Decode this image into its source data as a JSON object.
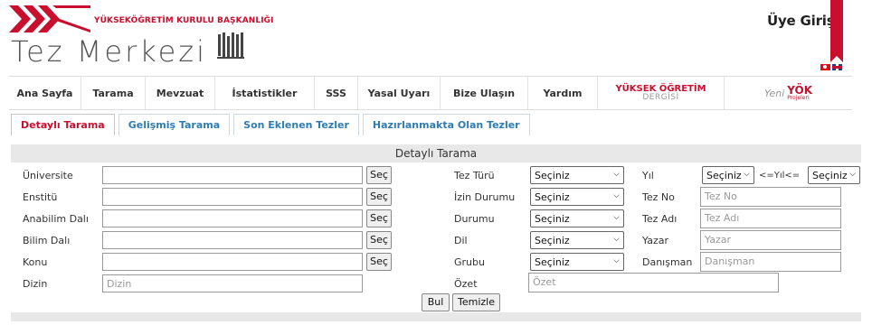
{
  "header": {
    "institution": "YÜKSEKÖĞRETİM KURULU BAŞKANLIĞI",
    "title": "Tez Merkezi",
    "login_label": "Üye Girişi"
  },
  "nav": {
    "items": [
      "Ana Sayfa",
      "Tarama",
      "Mevzuat",
      "İstatistikler",
      "SSS",
      "Yasal Uyarı",
      "Bize Ulaşın",
      "Yardım"
    ],
    "dergi_line1": "YÜKSEK ÖĞRETİM",
    "dergi_line2": "DERGİSİ",
    "yeni_label": "Yeni",
    "yok_label": "YÖK",
    "projeleri_label": "Projeleri"
  },
  "tabs": [
    "Detaylı Tarama",
    "Gelişmiş Tarama",
    "Son Eklenen Tezler",
    "Hazırlanmakta Olan Tezler"
  ],
  "form": {
    "title": "Detaylı Tarama",
    "left_labels": [
      "Üniversite",
      "Enstitü",
      "Anabilim Dalı",
      "Bilim Dalı",
      "Konu",
      "Dizin"
    ],
    "sec_label": "Seç",
    "dizin_placeholder": "Dizin",
    "mid_labels": [
      "Tez Türü",
      "İzin Durumu",
      "Durumu",
      "Dil",
      "Grubu",
      "Özet"
    ],
    "select_value": "Seçiniz",
    "ozet_placeholder": "Özet",
    "right_labels": [
      "Yıl",
      "Tez No",
      "Tez Adı",
      "Yazar",
      "Danışman"
    ],
    "year_sep": "<=Yıl<=",
    "right_placeholders": [
      "Tez No",
      "Tez Adı",
      "Yazar",
      "Danışman"
    ],
    "search_button": "Bul",
    "clear_button": "Temizle"
  },
  "colors": {
    "brand_red": "#c8102e",
    "tab_blue": "#2e7cb3"
  }
}
